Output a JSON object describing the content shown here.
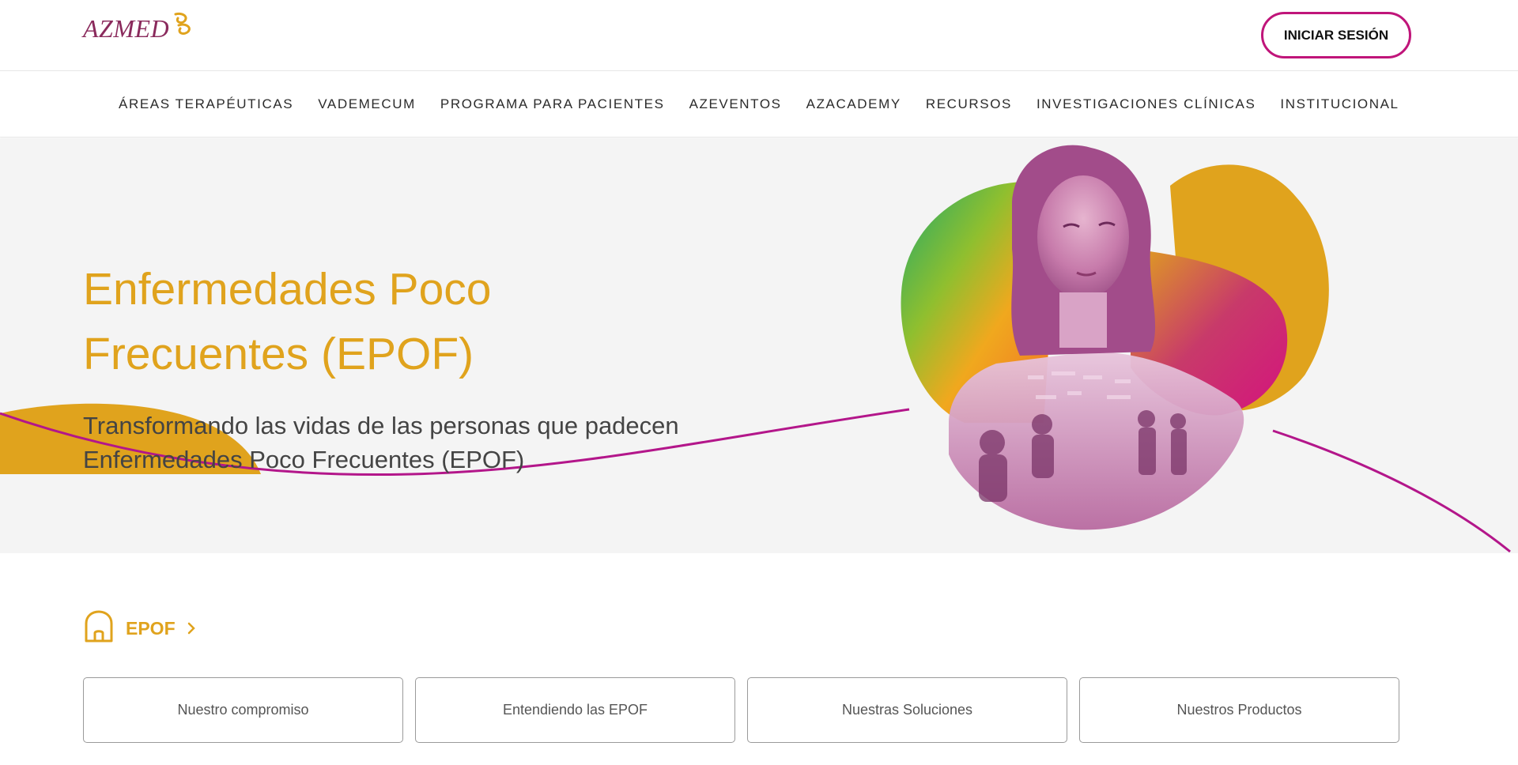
{
  "header": {
    "logo_text": "AZMED",
    "login_label": "INICIAR SESIÓN"
  },
  "nav": {
    "items": [
      "ÁREAS TERAPÉUTICAS",
      "VADEMECUM",
      "PROGRAMA PARA PACIENTES",
      "AZEVENTOS",
      "AZACADEMY",
      "RECURSOS",
      "INVESTIGACIONES CLÍNICAS",
      "INSTITUCIONAL"
    ]
  },
  "hero": {
    "title": "Enfermedades Poco Frecuentes (EPOF)",
    "subtitle": "Transformando las vidas de las personas que padecen Enfermedades Poco Frecuentes (EPOF)"
  },
  "breadcrumb": {
    "label": "EPOF"
  },
  "tabs": [
    "Nuestro compromiso",
    "Entendiendo las EPOF",
    "Nuestras Soluciones",
    "Nuestros Productos"
  ],
  "colors": {
    "brand_gold": "#e0a31d",
    "brand_magenta": "#c0157a",
    "logo_purple": "#8a2a5c",
    "hero_bg": "#f4f4f4"
  },
  "icons": {
    "breadcrumb_home": "home-icon",
    "breadcrumb_next": "chevron-right-icon"
  }
}
